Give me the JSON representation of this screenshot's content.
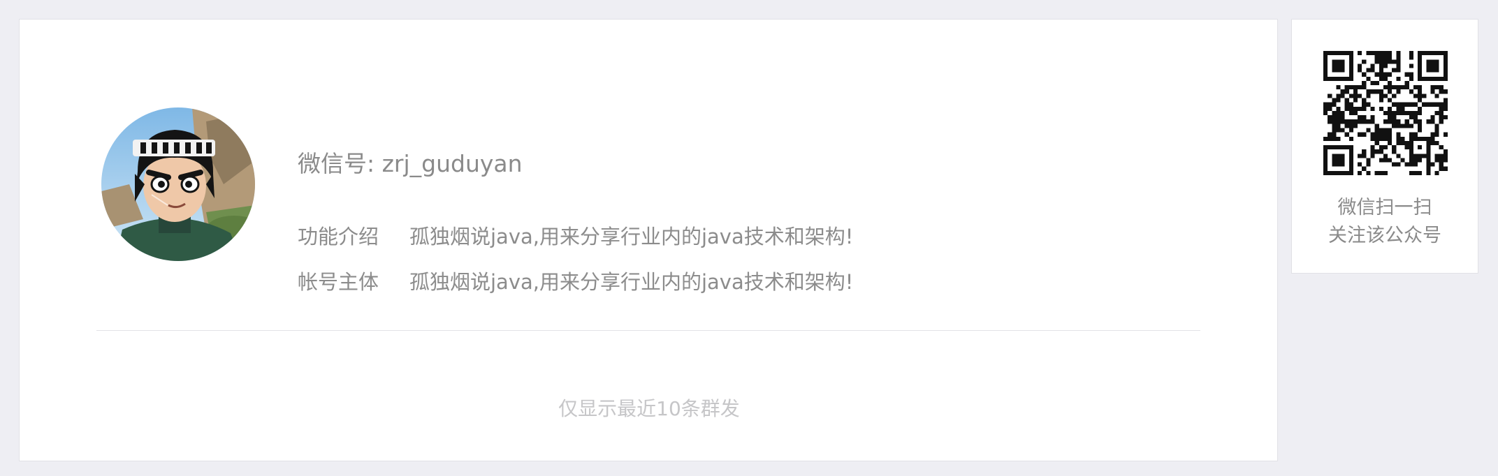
{
  "profile": {
    "avatar_icon": "anime-character-avatar",
    "wechat_id": "微信号: zrj_guduyan",
    "intro_label": "功能介绍",
    "intro_value": "孤独烟说java,用来分享行业内的java技术和架构!",
    "subject_label": "帐号主体",
    "subject_value": "孤独烟说java,用来分享行业内的java技术和架构!"
  },
  "messages": {
    "notice": "仅显示最近10条群发"
  },
  "qrcode": {
    "icon": "qr-code-icon",
    "tip_line1": "微信扫一扫",
    "tip_line2": "关注该公众号"
  }
}
